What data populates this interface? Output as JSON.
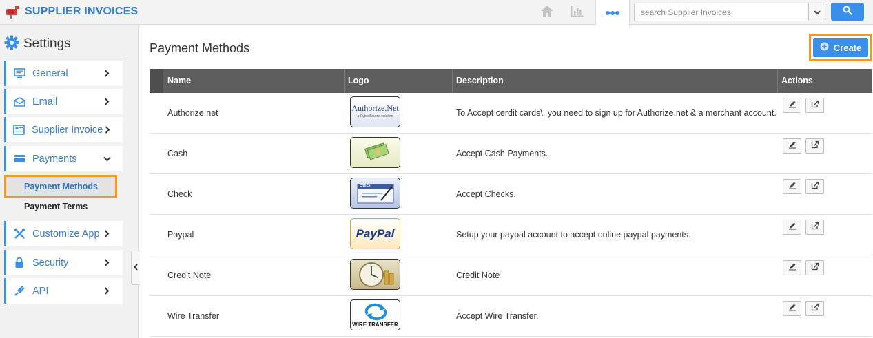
{
  "app": {
    "title": "SUPPLIER INVOICES",
    "logo_icon": "mailbox-icon"
  },
  "topbar": {
    "home_icon": "home-icon",
    "chart_icon": "bar-chart-icon",
    "more_icon": "more-dots-icon",
    "search_placeholder": "search Supplier Invoices",
    "search_icon": "search-icon"
  },
  "sidebar": {
    "title": "Settings",
    "title_icon": "gear-icon",
    "items": [
      {
        "label": "General",
        "icon": "monitor-icon",
        "expanded": false
      },
      {
        "label": "Email",
        "icon": "envelope-icon",
        "expanded": false
      },
      {
        "label": "Supplier Invoice",
        "icon": "invoice-icon",
        "expanded": false
      },
      {
        "label": "Payments",
        "icon": "credit-card-icon",
        "expanded": true
      },
      {
        "label": "Customize App",
        "icon": "tools-icon",
        "expanded": false
      },
      {
        "label": "Security",
        "icon": "lock-icon",
        "expanded": false
      },
      {
        "label": "API",
        "icon": "plug-icon",
        "expanded": false
      }
    ],
    "sub_items": [
      {
        "label": "Payment Methods",
        "active": true
      },
      {
        "label": "Payment Terms",
        "active": false
      }
    ]
  },
  "main": {
    "title": "Payment Methods",
    "create_label": "Create",
    "columns": [
      "Name",
      "Logo",
      "Description",
      "Actions"
    ],
    "rows": [
      {
        "name": "Authorize.net",
        "logo": "authorize-net-logo",
        "logo_text": "Authorize.Net",
        "logo_subtext": "a CyberSource solution",
        "description": "To Accept cerdit cards\\, you need to sign up for Authorize.net & a merchant account."
      },
      {
        "name": "Cash",
        "logo": "cash-logo",
        "description": "Accept Cash Payments."
      },
      {
        "name": "Check",
        "logo": "check-logo",
        "logo_text": "check",
        "description": "Accept Checks."
      },
      {
        "name": "Paypal",
        "logo": "paypal-logo",
        "logo_text": "PayPal",
        "description": "Setup your paypal account to accept online paypal payments."
      },
      {
        "name": "Credit Note",
        "logo": "credit-note-logo",
        "description": "Credit Note"
      },
      {
        "name": "Wire Transfer",
        "logo": "wire-transfer-logo",
        "logo_text": "WIRE TRANSFER",
        "description": "Accept Wire Transfer."
      }
    ]
  },
  "colors": {
    "accent": "#3a8fe8",
    "highlight": "#f39a1d",
    "header_bg": "#5e5e5e"
  }
}
